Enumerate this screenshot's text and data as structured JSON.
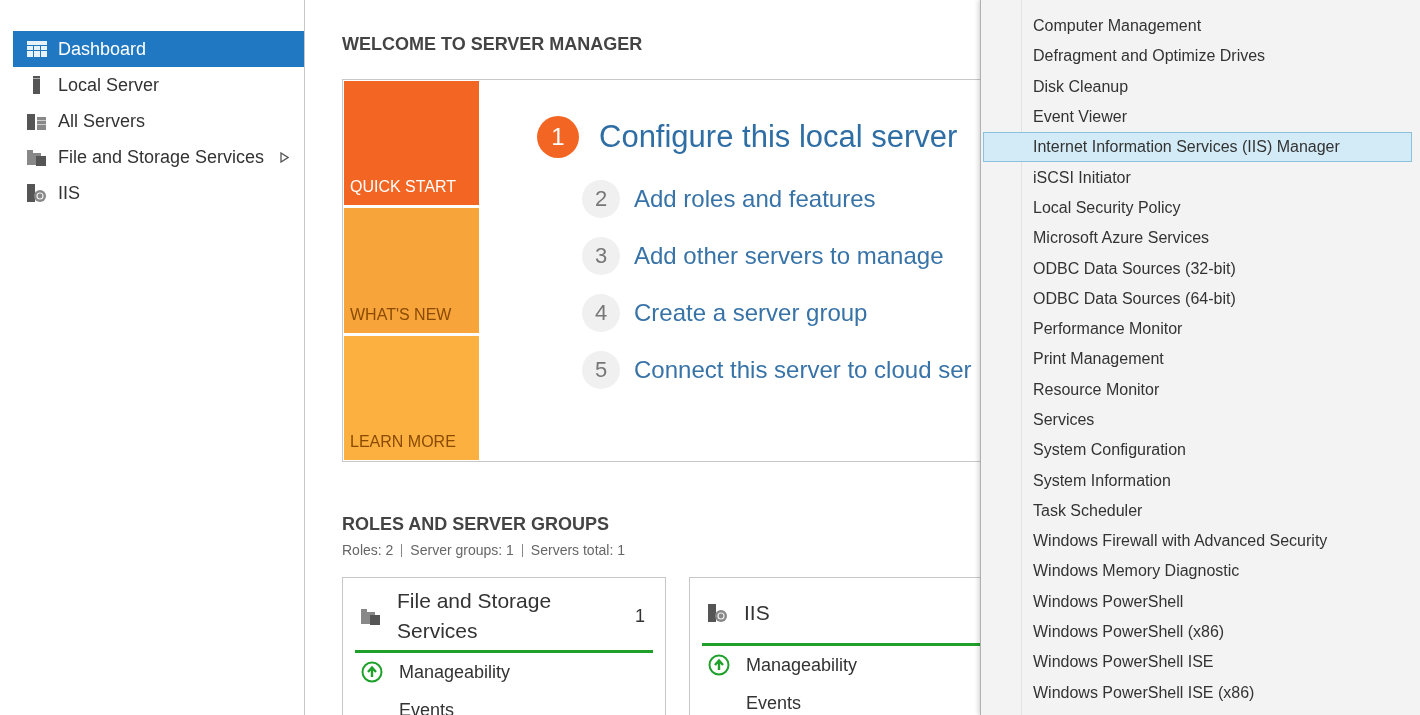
{
  "sidebar": {
    "items": [
      {
        "label": "Dashboard",
        "kind": "dashboard",
        "selected": true,
        "has_submenu": false
      },
      {
        "label": "Local Server",
        "kind": "server",
        "selected": false,
        "has_submenu": false
      },
      {
        "label": "All Servers",
        "kind": "servers",
        "selected": false,
        "has_submenu": false
      },
      {
        "label": "File and Storage Services",
        "kind": "files",
        "selected": false,
        "has_submenu": true
      },
      {
        "label": "IIS",
        "kind": "iis",
        "selected": false,
        "has_submenu": false
      }
    ]
  },
  "welcome": {
    "title": "WELCOME TO SERVER MANAGER",
    "tiles": [
      {
        "label": "QUICK START",
        "color": "#f26522",
        "selected": true
      },
      {
        "label": "WHAT'S NEW",
        "color": "#f7a43b",
        "selected": false
      },
      {
        "label": "LEARN MORE",
        "color": "#fbb040",
        "selected": false
      }
    ],
    "steps": [
      {
        "number": "1",
        "label": "Configure this local server",
        "primary": true
      },
      {
        "number": "2",
        "label": "Add roles and features",
        "primary": false
      },
      {
        "number": "3",
        "label": "Add other servers to manage",
        "primary": false
      },
      {
        "number": "4",
        "label": "Create a server group",
        "primary": false
      },
      {
        "number": "5",
        "label": "Connect this server to cloud ser",
        "primary": false
      }
    ]
  },
  "roles": {
    "title": "ROLES AND SERVER GROUPS",
    "summary": [
      "Roles: 2",
      "Server groups: 1",
      "Servers total: 1"
    ],
    "cards": [
      {
        "title": "File and Storage Services",
        "kind": "files",
        "count": "1",
        "rows": [
          {
            "label": "Manageability",
            "kind": "ok"
          },
          {
            "label": "Events",
            "kind": "none"
          }
        ]
      },
      {
        "title": "IIS",
        "kind": "iis",
        "rows": [
          {
            "label": "Manageability",
            "kind": "ok"
          },
          {
            "label": "Events",
            "kind": "none"
          }
        ]
      }
    ]
  },
  "tools_menu": {
    "items": [
      {
        "label": "Computer Management",
        "selected": false
      },
      {
        "label": "Defragment and Optimize Drives",
        "selected": false
      },
      {
        "label": "Disk Cleanup",
        "selected": false
      },
      {
        "label": "Event Viewer",
        "selected": false
      },
      {
        "label": "Internet Information Services (IIS) Manager",
        "selected": true
      },
      {
        "label": "iSCSI Initiator",
        "selected": false
      },
      {
        "label": "Local Security Policy",
        "selected": false
      },
      {
        "label": "Microsoft Azure Services",
        "selected": false
      },
      {
        "label": "ODBC Data Sources (32-bit)",
        "selected": false
      },
      {
        "label": "ODBC Data Sources (64-bit)",
        "selected": false
      },
      {
        "label": "Performance Monitor",
        "selected": false
      },
      {
        "label": "Print Management",
        "selected": false
      },
      {
        "label": "Resource Monitor",
        "selected": false
      },
      {
        "label": "Services",
        "selected": false
      },
      {
        "label": "System Configuration",
        "selected": false
      },
      {
        "label": "System Information",
        "selected": false
      },
      {
        "label": "Task Scheduler",
        "selected": false
      },
      {
        "label": "Windows Firewall with Advanced Security",
        "selected": false
      },
      {
        "label": "Windows Memory Diagnostic",
        "selected": false
      },
      {
        "label": "Windows PowerShell",
        "selected": false
      },
      {
        "label": "Windows PowerShell (x86)",
        "selected": false
      },
      {
        "label": "Windows PowerShell ISE",
        "selected": false
      },
      {
        "label": "Windows PowerShell ISE (x86)",
        "selected": false
      }
    ]
  }
}
